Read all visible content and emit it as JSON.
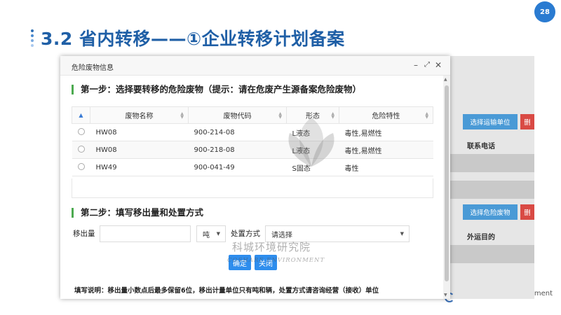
{
  "slide": {
    "title": "3.2 省内转移——①企业转移计划备案",
    "page_number": "28"
  },
  "background": {
    "select_transport_button": "选择运输单位",
    "select_waste_button": "选择危险废物",
    "delete_button_1": "删",
    "delete_button_2": "删",
    "contact_phone_label": "联系电话",
    "destination_label": "外运目的",
    "footer_fragment": "ment"
  },
  "dialog": {
    "title": "危险废物信息",
    "step1": "第一步：选择要转移的危险废物（提示：请在危废产生源备案危险废物）",
    "columns": [
      "废物名称",
      "废物代码",
      "形态",
      "危险特性"
    ],
    "rows": [
      {
        "name": "HW08",
        "code": "900-214-08",
        "form": "L液态",
        "hazard": "毒性,易燃性"
      },
      {
        "name": "HW08",
        "code": "900-218-08",
        "form": "L液态",
        "hazard": "毒性,易燃性"
      },
      {
        "name": "HW49",
        "code": "900-041-49",
        "form": "S固态",
        "hazard": "毒性"
      }
    ],
    "step2": "第二步：填写移出量和处置方式",
    "amount_label": "移出量",
    "amount_value": "",
    "unit_value": "吨",
    "method_label": "处置方式",
    "method_placeholder": "请选择",
    "confirm_button": "确定",
    "close_button": "关闭",
    "note": "填写说明：移出量小数点后最多保留6位，移出计量单位只有吨和辆，处置方式请咨询经营（接收）单位"
  },
  "watermark": {
    "text": "科城环境研究院",
    "subtext": "COSHARE ENVIRONMENT"
  },
  "colors": {
    "title_blue": "#1f5fa6",
    "step_green": "#4caa50",
    "button_blue": "#2e8ded",
    "bg_button_blue": "#4a9ad6",
    "bg_button_red": "#d94a44"
  },
  "icons": [
    "minimize-icon",
    "maximize-icon",
    "close-icon",
    "sort-icon",
    "chevron-down-icon"
  ]
}
